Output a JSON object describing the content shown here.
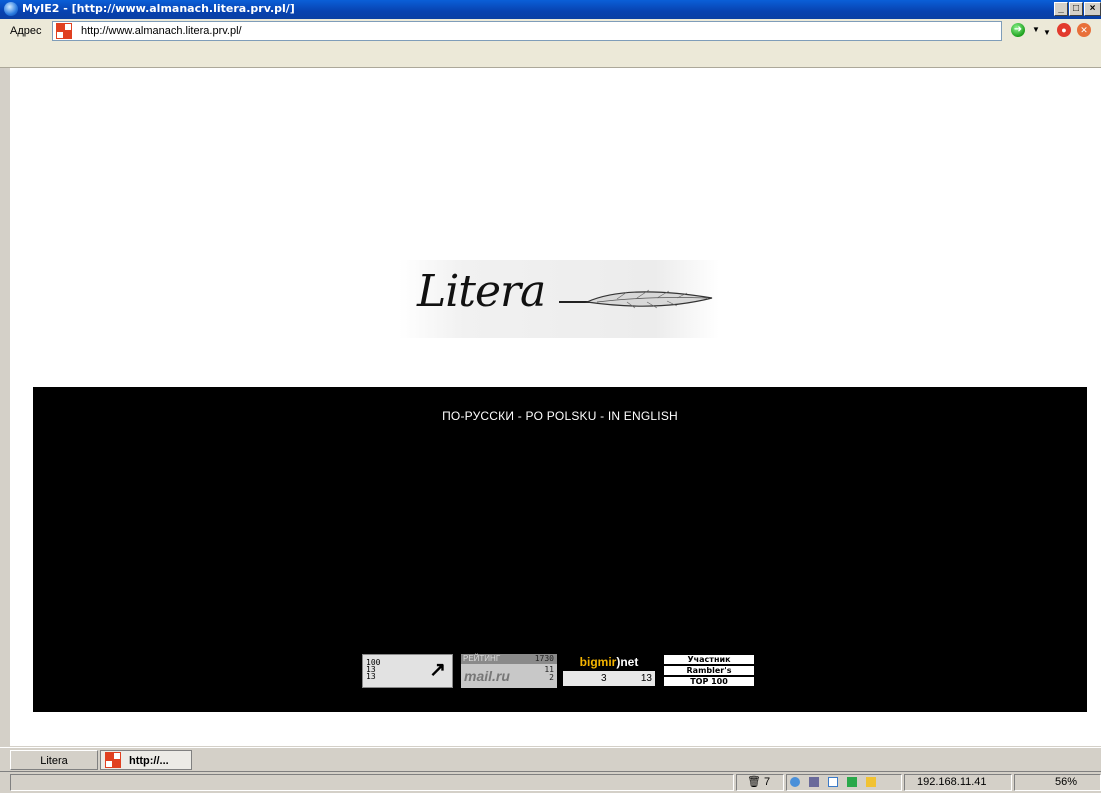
{
  "window": {
    "title": "MyIE2 - [http://www.almanach.litera.prv.pl/]",
    "btn_min": "_",
    "btn_max": "□",
    "btn_close": "×"
  },
  "address_bar": {
    "label": "Адрес",
    "url": "http://www.almanach.litera.prv.pl/"
  },
  "logo": {
    "text": "Litera"
  },
  "languages": {
    "ru": "ПО-РУССКИ",
    "sep": " - ",
    "pl": "PO POLSKU",
    "en": "IN ENGLISH"
  },
  "counters": {
    "c1": {
      "lines": [
        "100",
        "13",
        "13"
      ],
      "arrow": "↗"
    },
    "mail": {
      "header": "РЕЙТИНГ",
      "value": "1730",
      "brand": "mail.ru",
      "v2": "11",
      "v3": "2"
    },
    "bigmir": {
      "brand_a": "bigmir",
      "brand_b": ")net",
      "a": "3",
      "b": "13"
    },
    "rambler": {
      "l1": "Участник",
      "l2": "Rambler's",
      "l3": "TOP 100"
    }
  },
  "tabs": [
    {
      "label": "Litera"
    },
    {
      "label": "http://..."
    }
  ],
  "status": {
    "count": "7",
    "ip": "192.168.11.41",
    "zoom": "56%"
  }
}
